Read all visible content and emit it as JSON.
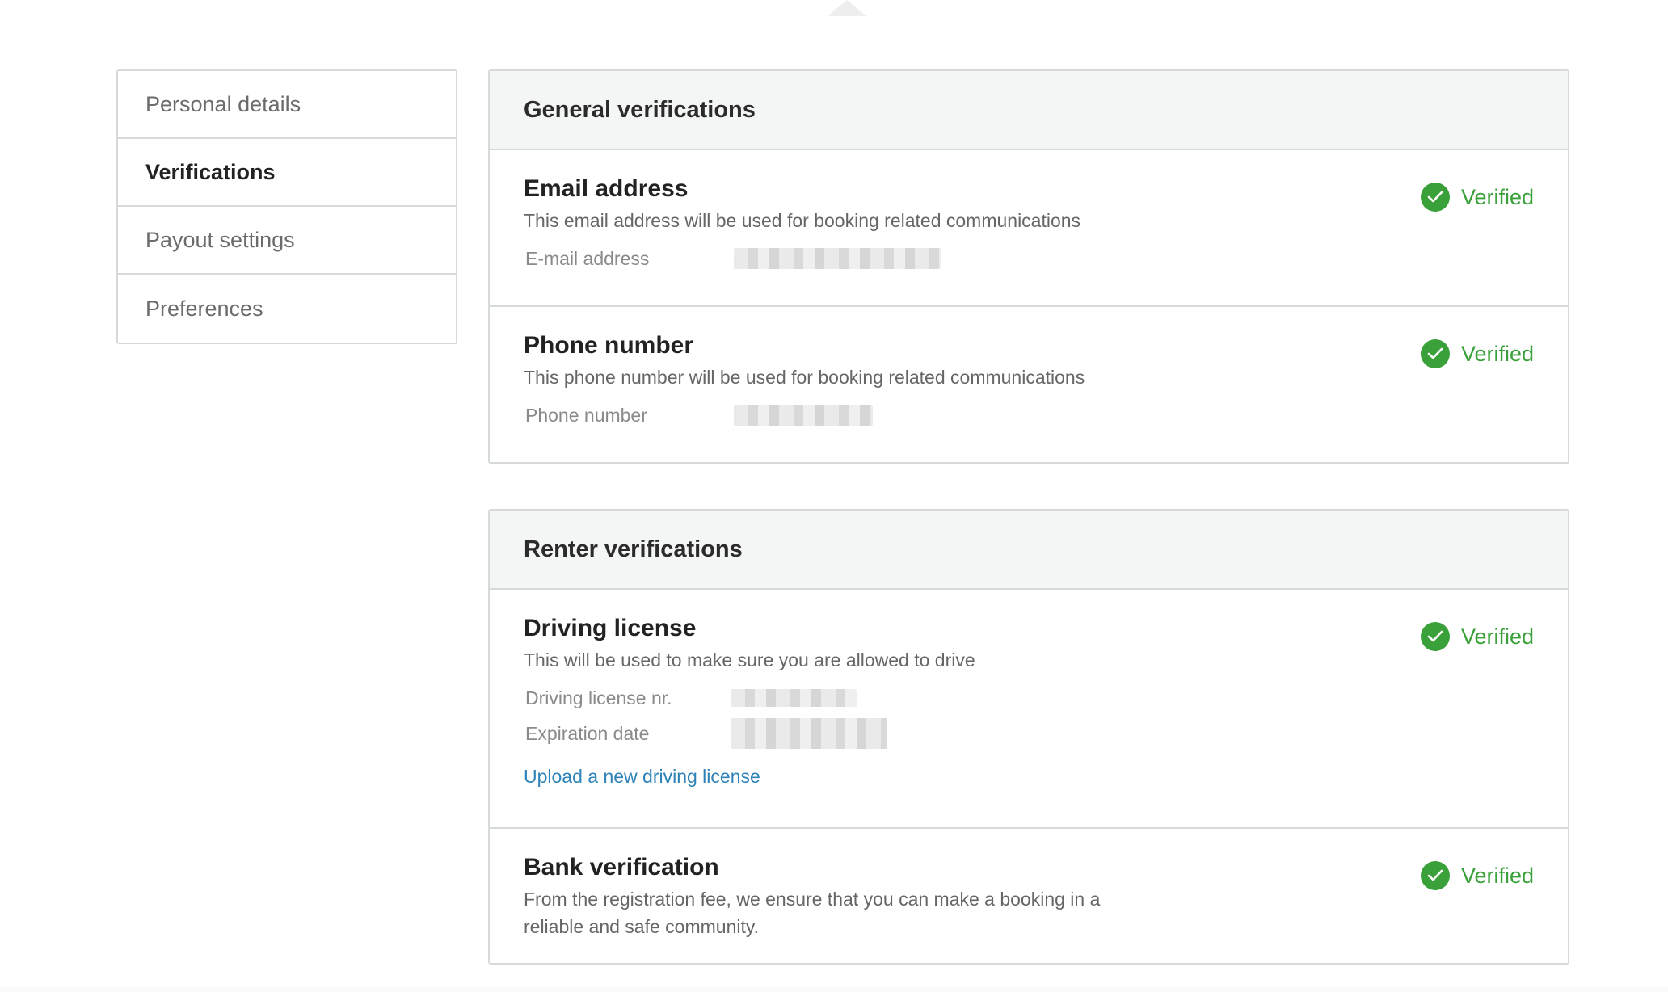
{
  "sidebar": {
    "items": [
      {
        "label": "Personal details"
      },
      {
        "label": "Verifications"
      },
      {
        "label": "Payout settings"
      },
      {
        "label": "Preferences"
      }
    ]
  },
  "general": {
    "title": "General verifications",
    "email": {
      "title": "Email address",
      "description": "This email address will be used for booking related communications",
      "field_label": "E-mail address",
      "status": "Verified"
    },
    "phone": {
      "title": "Phone number",
      "description": "This phone number will be used for booking related communications",
      "field_label": "Phone number",
      "status": "Verified"
    }
  },
  "renter": {
    "title": "Renter verifications",
    "license": {
      "title": "Driving license",
      "description": "This will be used to make sure you are allowed to drive",
      "number_label": "Driving license nr.",
      "expiration_label": "Expiration date",
      "upload_link": "Upload a new driving license",
      "status": "Verified"
    },
    "bank": {
      "title": "Bank verification",
      "description_line1": "From the registration fee, we ensure that you can make a booking in a",
      "description_line2": "reliable and safe community.",
      "status": "Verified"
    }
  },
  "colors": {
    "verified_green": "#3aa13a",
    "link_blue": "#2d82b7",
    "border": "#d6dadb",
    "header_bg": "#f4f5f5"
  },
  "icons": [
    "check-circle-icon",
    "caret-up-icon"
  ]
}
